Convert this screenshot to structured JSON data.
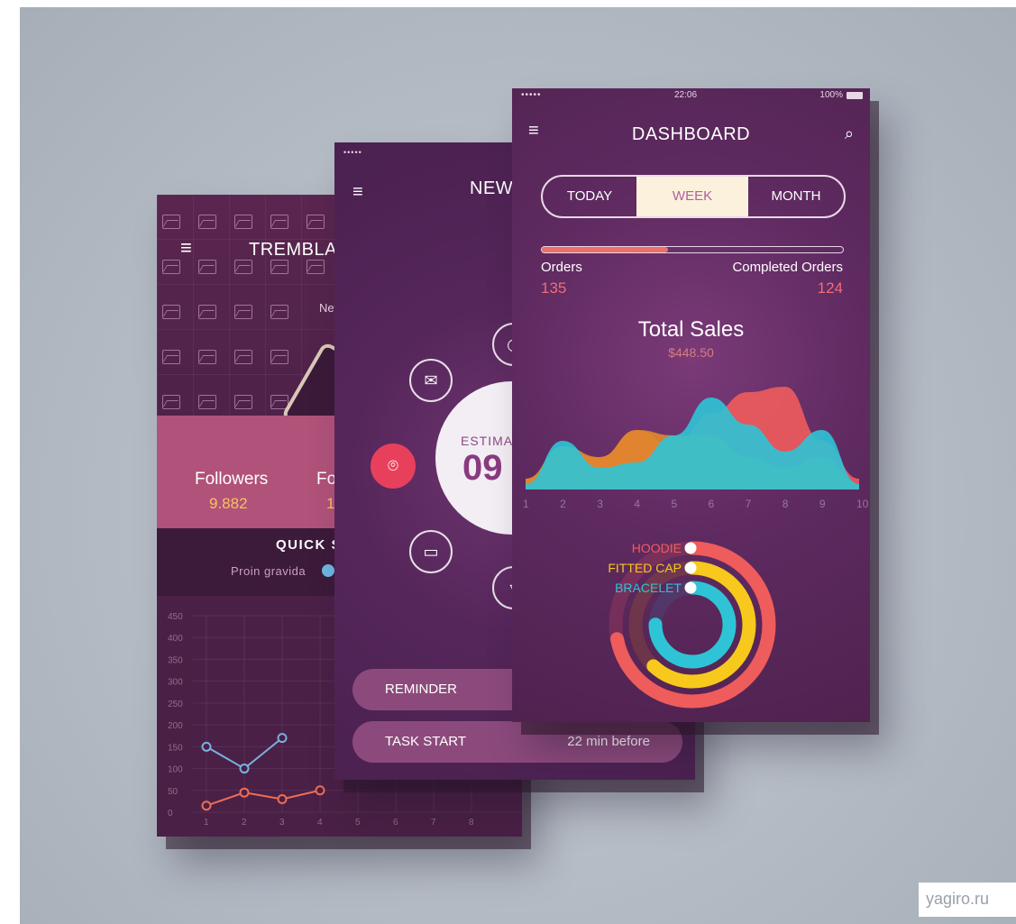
{
  "phone_left": {
    "title": "TREMBLAY",
    "subtitle": "New Y",
    "stats": [
      {
        "label": "Followers",
        "value": "9.882"
      },
      {
        "label": "Fo",
        "value": "1"
      }
    ],
    "quick_title": "QUICK S",
    "quick_legend": "Proin gravida",
    "chart_data": {
      "type": "line",
      "x": [
        1,
        2,
        3,
        4,
        5,
        6,
        7,
        8
      ],
      "ylim": [
        0,
        450
      ],
      "yticks": [
        0,
        50,
        100,
        150,
        200,
        250,
        300,
        350,
        400,
        450
      ],
      "series": [
        {
          "color": "#7ab0e0",
          "values": [
            150,
            100,
            170
          ]
        },
        {
          "color": "#ee6e55",
          "values": [
            15,
            45,
            30,
            50
          ]
        }
      ]
    }
  },
  "phone_middle": {
    "status_dots": "•••••",
    "title": "NEW",
    "icons": [
      "mail-icon",
      "chat-icon",
      "location-icon"
    ],
    "estimate_label": "ESTIMA",
    "estimate_value": "09",
    "reminders": [
      {
        "label": "REMINDER",
        "time": ""
      },
      {
        "label": "TASK START",
        "time": "22 min before"
      }
    ]
  },
  "phone_right": {
    "status_dots": "•••••",
    "time": "22:06",
    "battery": "100%",
    "title": "DASHBOARD",
    "tabs": [
      "TODAY",
      "WEEK",
      "MONTH"
    ],
    "active_tab": "WEEK",
    "orders_label": "Orders",
    "orders_value": "135",
    "completed_label": "Completed Orders",
    "completed_value": "124",
    "orders_progress": 0.42,
    "total_sales_label": "Total Sales",
    "total_sales_value": "$448.50",
    "area_chart": {
      "type": "area",
      "x": [
        1,
        2,
        3,
        4,
        5,
        6,
        7,
        8,
        9,
        10
      ],
      "series": [
        {
          "color": "#ee5c5c",
          "values": [
            0.1,
            0.35,
            0.3,
            0.55,
            0.4,
            0.7,
            0.9,
            0.95,
            0.45,
            0.1
          ]
        },
        {
          "color": "#e08a2a",
          "values": [
            0.1,
            0.4,
            0.3,
            0.55,
            0.5,
            0.5,
            0.3,
            0.2,
            0.3,
            0.05
          ]
        },
        {
          "color": "#2ec4d6",
          "values": [
            0.05,
            0.45,
            0.2,
            0.25,
            0.5,
            0.85,
            0.6,
            0.35,
            0.55,
            0.05
          ]
        }
      ]
    },
    "rings": [
      {
        "label": "HOODIE",
        "color": "#ee5c5c",
        "value": 0.72
      },
      {
        "label": "FITTED CAP",
        "color": "#f6c91c",
        "value": 0.62
      },
      {
        "label": "BRACELET",
        "color": "#2ec4d6",
        "value": 0.75
      }
    ]
  },
  "watermark": "yagiro.ru"
}
